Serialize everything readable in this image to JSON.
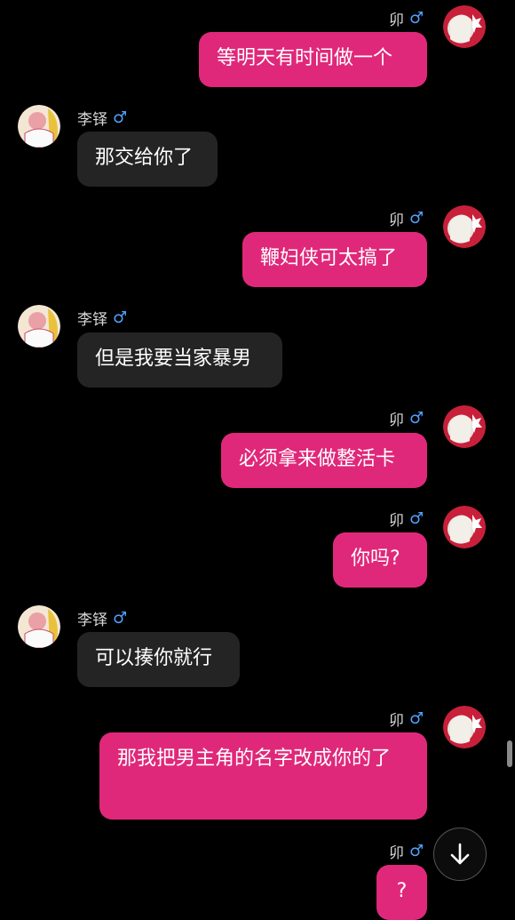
{
  "self": {
    "name": "卯",
    "gender": "♂"
  },
  "other": {
    "name": "李铎",
    "gender": "♂"
  },
  "messages": [
    {
      "text": "等明天有时间做一个"
    },
    {
      "text": "那交给你了"
    },
    {
      "text": "鞭妇侠可太搞了"
    },
    {
      "text": "但是我要当家暴男"
    },
    {
      "text": "必须拿来做整活卡"
    },
    {
      "text": "你吗?"
    },
    {
      "text": "可以揍你就行"
    },
    {
      "text": "那我把男主角的名字改成你的了"
    },
    {
      "text": "?"
    }
  ],
  "icons": {
    "scroll_down": "arrow-down-icon"
  },
  "colors": {
    "outgoing_bubble": "#e0287a",
    "incoming_bubble": "#242424",
    "gender": "#4fa3ff"
  }
}
